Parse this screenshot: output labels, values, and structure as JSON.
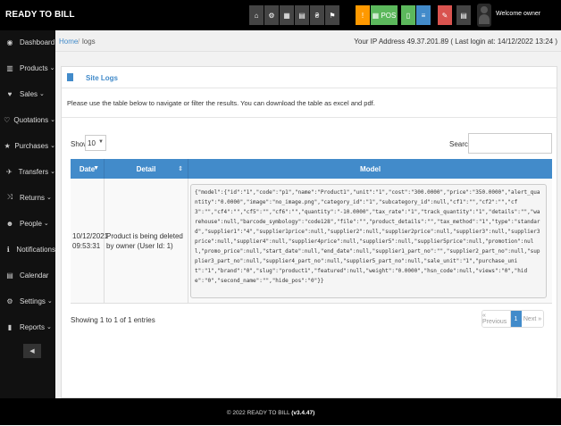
{
  "app": {
    "brand": "READY TO BILL"
  },
  "topbar": {
    "buttons": [
      {
        "icon": "home-icon",
        "glyph": "⌂",
        "color": "#444444"
      },
      {
        "icon": "settings-icon",
        "glyph": "⚙",
        "color": "#444444"
      },
      {
        "icon": "calculator-icon",
        "glyph": "▦",
        "color": "#444444"
      },
      {
        "icon": "calendar-icon",
        "glyph": "▤",
        "color": "#444444"
      },
      {
        "icon": "language-icon",
        "glyph": "₴",
        "color": "#444444"
      },
      {
        "icon": "flag-icon",
        "glyph": "⚑",
        "color": "#444444"
      },
      {
        "icon": "alert-icon",
        "glyph": "!",
        "color": "#ff9900"
      },
      {
        "icon": "pos-icon",
        "glyph": "▦ POS",
        "color": "#5cb85c"
      },
      {
        "icon": "sound-icon",
        "glyph": "▯",
        "color": "#5cb85c"
      },
      {
        "icon": "list-icon",
        "glyph": "≡",
        "color": "#428bca"
      },
      {
        "icon": "power-icon",
        "glyph": "✎",
        "color": "#d9534f"
      },
      {
        "icon": "grid-icon",
        "glyph": "▤",
        "color": "#444444"
      }
    ],
    "welcome": "Welcome owner"
  },
  "sidebar": {
    "items": [
      {
        "icon": "dashboard-icon",
        "glyph": "◉",
        "label": "Dashboard",
        "caret": ""
      },
      {
        "icon": "products-icon",
        "glyph": "▥",
        "label": "Products",
        "caret": "⌄"
      },
      {
        "icon": "sales-icon",
        "glyph": "♥",
        "label": "Sales",
        "caret": "⌄"
      },
      {
        "icon": "quotations-icon",
        "glyph": "♡",
        "label": "Quotations",
        "caret": "⌄"
      },
      {
        "icon": "purchases-icon",
        "glyph": "★",
        "label": "Purchases",
        "caret": "⌄"
      },
      {
        "icon": "transfers-icon",
        "glyph": "✈",
        "label": "Transfers",
        "caret": "⌄"
      },
      {
        "icon": "returns-icon",
        "glyph": "⤨",
        "label": "Returns",
        "caret": "⌄"
      },
      {
        "icon": "people-icon",
        "glyph": "☻",
        "label": "People",
        "caret": "⌄"
      },
      {
        "icon": "notifications-icon",
        "glyph": "ℹ",
        "label": "Notifications",
        "caret": ""
      },
      {
        "icon": "calendar-icon",
        "glyph": "▤",
        "label": "Calendar",
        "caret": ""
      },
      {
        "icon": "settings-icon",
        "glyph": "⚙",
        "label": "Settings",
        "caret": "⌄"
      },
      {
        "icon": "reports-icon",
        "glyph": "▮",
        "label": "Reports",
        "caret": "⌄"
      }
    ],
    "toggle": "◀"
  },
  "breadcrumb": {
    "home": "Home",
    "sep": "/",
    "current": "logs",
    "ip_info": "Your IP Address 49.37.201.89 ( Last login at: 14/12/2022 13:24 )"
  },
  "panel": {
    "title": "Site Logs",
    "intro": "Please use the table below to navigate or filter the results. You can download the table as excel and pdf."
  },
  "table": {
    "show_label": "Show",
    "show_value": "10",
    "search_label": "Search",
    "search_value": "",
    "headers": {
      "date": "Date",
      "detail": "Detail",
      "model": "Model"
    },
    "rows": [
      {
        "date": "10/12/2021 09:53:31",
        "detail": "Product is being deleted by owner (User Id: 1)",
        "model": "{\"model\":{\"id\":\"1\",\"code\":\"p1\",\"name\":\"Product1\",\"unit\":\"1\",\"cost\":\"300.0000\",\"price\":\"350.0000\",\"alert_quantity\":\"0.0000\",\"image\":\"no_image.png\",\"category_id\":\"1\",\"subcategory_id\":null,\"cf1\":\"\",\"cf2\":\"\",\"cf3\":\"\",\"cf4\":\"\",\"cf5\":\"\",\"cf6\":\"\",\"quantity\":\"-10.0000\",\"tax_rate\":\"1\",\"track_quantity\":\"1\",\"details\":\"\",\"warehouse\":null,\"barcode_symbology\":\"code128\",\"file\":\"\",\"product_details\":\"\",\"tax_method\":\"1\",\"type\":\"standard\",\"supplier1\":\"4\",\"supplier1price\":null,\"supplier2\":null,\"supplier2price\":null,\"supplier3\":null,\"supplier3price\":null,\"supplier4\":null,\"supplier4price\":null,\"supplier5\":null,\"supplier5price\":null,\"promotion\":null,\"promo_price\":null,\"start_date\":null,\"end_date\":null,\"supplier1_part_no\":\"\",\"supplier2_part_no\":null,\"supplier3_part_no\":null,\"supplier4_part_no\":null,\"supplier5_part_no\":null,\"sale_unit\":\"1\",\"purchase_unit\":\"1\",\"brand\":\"0\",\"slug\":\"product1\",\"featured\":null,\"weight\":\"0.0000\",\"hsn_code\":null,\"views\":\"0\",\"hide\":\"0\",\"second_name\":\"\",\"hide_pos\":\"0\"}}"
      }
    ],
    "info": "Showing 1 to 1 of 1 entries",
    "pager": {
      "prev": "« Previous",
      "page": "1",
      "next": "Next »"
    }
  },
  "footer": {
    "text": "© 2022 READY TO BILL",
    "version": "(v3.4.47)"
  }
}
